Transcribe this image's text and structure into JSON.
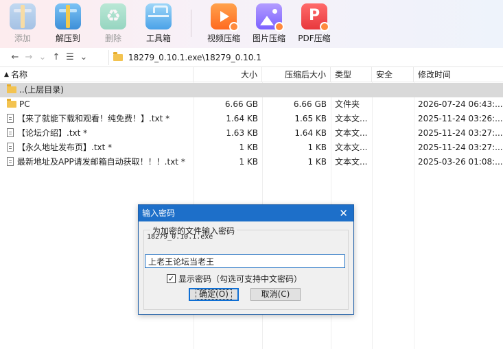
{
  "toolbar": {
    "items": [
      {
        "label": "添加",
        "icon": "archive-add-icon",
        "enabled": false
      },
      {
        "label": "解压到",
        "icon": "extract-icon",
        "enabled": true
      },
      {
        "label": "删除",
        "icon": "recycle-delete-icon",
        "enabled": false
      },
      {
        "label": "工具箱",
        "icon": "toolbox-icon",
        "enabled": true
      },
      {
        "label": "视频压缩",
        "icon": "video-compress-icon",
        "enabled": true
      },
      {
        "label": "图片压缩",
        "icon": "image-compress-icon",
        "enabled": true
      },
      {
        "label": "PDF压缩",
        "icon": "pdf-compress-icon",
        "enabled": true
      }
    ]
  },
  "address": {
    "path": "18279_0.10.1.exe\\18279_0.10.1"
  },
  "columns": {
    "name": "名称",
    "size": "大小",
    "packed": "压缩后大小",
    "type": "类型",
    "security": "安全",
    "modified": "修改时间"
  },
  "rows": [
    {
      "name": "..(上层目录)",
      "size": "",
      "packed": "",
      "type": "",
      "security": "",
      "modified": "",
      "kind": "up"
    },
    {
      "name": "PC",
      "size": "6.66 GB",
      "packed": "6.66 GB",
      "type": "文件夹",
      "security": "",
      "modified": "2026-07-24 06:43:...",
      "kind": "folder"
    },
    {
      "name": "【来了就能下载和观看！纯免费！】.txt *",
      "size": "1.64 KB",
      "packed": "1.65 KB",
      "type": "文本文...",
      "security": "",
      "modified": "2025-11-24 03:26:...",
      "kind": "file"
    },
    {
      "name": "【论坛介绍】.txt *",
      "size": "1.63 KB",
      "packed": "1.64 KB",
      "type": "文本文...",
      "security": "",
      "modified": "2025-11-24 03:27:...",
      "kind": "file"
    },
    {
      "name": "【永久地址发布页】.txt *",
      "size": "1 KB",
      "packed": "1 KB",
      "type": "文本文...",
      "security": "",
      "modified": "2025-11-24 03:27:...",
      "kind": "file"
    },
    {
      "name": "最新地址及APP请发邮箱自动获取！！！.txt *",
      "size": "1 KB",
      "packed": "1 KB",
      "type": "文本文...",
      "security": "",
      "modified": "2025-03-26 01:08:...",
      "kind": "file"
    }
  ],
  "dialog": {
    "title": "输入密码",
    "group_label": "为加密的文件输入密码",
    "filename": "18279_0.10.1.exe",
    "password_value": "上老王论坛当老王",
    "show_password_label": "显示密码（勾选可支持中文密码）",
    "show_password_checked": true,
    "ok_label": "确定(O)",
    "cancel_label": "取消(C)"
  },
  "colors": {
    "accent": "#1d6fc9",
    "selected_row": "#d9d9d9"
  }
}
